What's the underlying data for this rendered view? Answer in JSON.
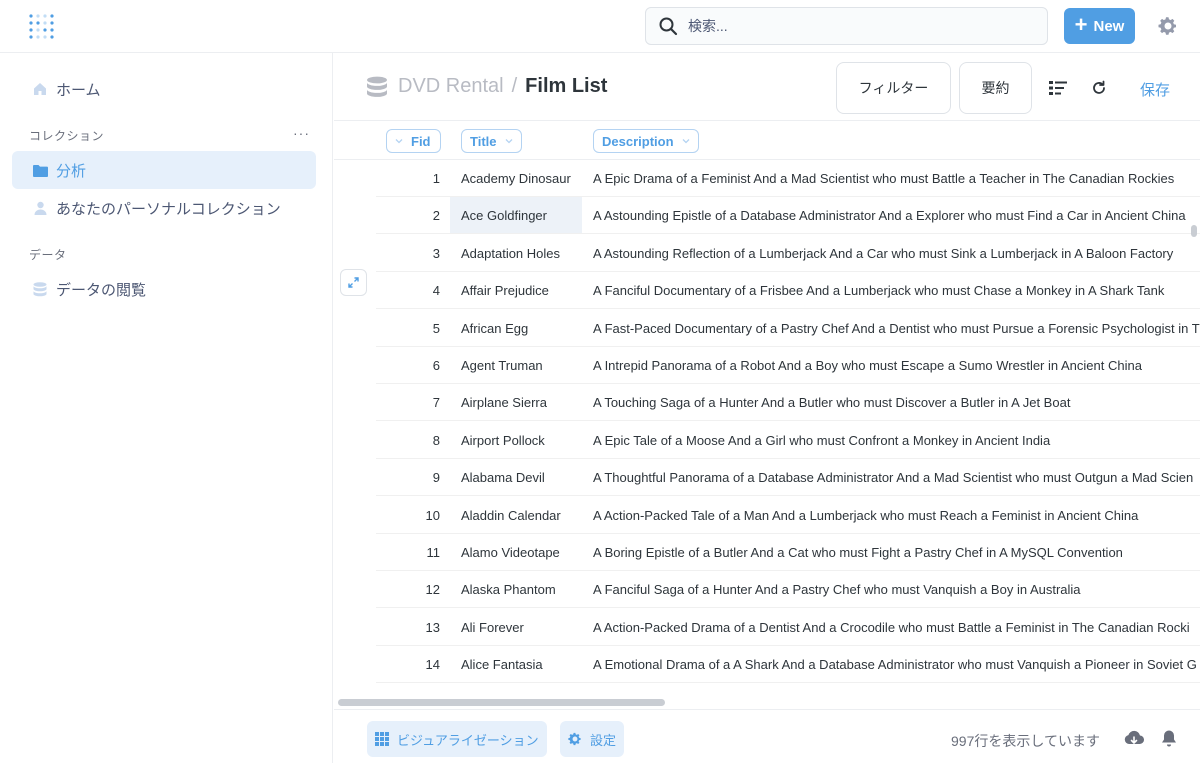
{
  "colors": {
    "brand": "#509ee3",
    "text": "#2e353b",
    "muted": "#696e7b"
  },
  "search": {
    "placeholder": "検索..."
  },
  "topbar": {
    "new_label": "New"
  },
  "sidebar": {
    "home_label": "ホーム",
    "collections_label": "コレクション",
    "more_label": "···",
    "items": [
      {
        "label": "分析",
        "icon": "folder-icon",
        "active": true
      },
      {
        "label": "あなたのパーソナルコレクション",
        "icon": "person-icon",
        "active": false
      }
    ],
    "data_label": "データ",
    "browse_label": "データの閲覧"
  },
  "header": {
    "database": "DVD Rental",
    "separator": "/",
    "title": "Film List",
    "filter_label": "フィルター",
    "summarize_label": "要約",
    "save_label": "保存"
  },
  "table": {
    "columns": [
      "Fid",
      "Title",
      "Description"
    ],
    "rows": [
      {
        "fid": "1",
        "title": "Academy Dinosaur",
        "description": "A Epic Drama of a Feminist And a Mad Scientist who must Battle a Teacher in The Canadian Rockies"
      },
      {
        "fid": "2",
        "title": "Ace Goldfinger",
        "description": "A Astounding Epistle of a Database Administrator And a Explorer who must Find a Car in Ancient China"
      },
      {
        "fid": "3",
        "title": "Adaptation Holes",
        "description": "A Astounding Reflection of a Lumberjack And a Car who must Sink a Lumberjack in A Baloon Factory"
      },
      {
        "fid": "4",
        "title": "Affair Prejudice",
        "description": "A Fanciful Documentary of a Frisbee And a Lumberjack who must Chase a Monkey in A Shark Tank"
      },
      {
        "fid": "5",
        "title": "African Egg",
        "description": "A Fast-Paced Documentary of a Pastry Chef And a Dentist who must Pursue a Forensic Psychologist in T"
      },
      {
        "fid": "6",
        "title": "Agent Truman",
        "description": "A Intrepid Panorama of a Robot And a Boy who must Escape a Sumo Wrestler in Ancient China"
      },
      {
        "fid": "7",
        "title": "Airplane Sierra",
        "description": "A Touching Saga of a Hunter And a Butler who must Discover a Butler in A Jet Boat"
      },
      {
        "fid": "8",
        "title": "Airport Pollock",
        "description": "A Epic Tale of a Moose And a Girl who must Confront a Monkey in Ancient India"
      },
      {
        "fid": "9",
        "title": "Alabama Devil",
        "description": "A Thoughtful Panorama of a Database Administrator And a Mad Scientist who must Outgun a Mad Scien"
      },
      {
        "fid": "10",
        "title": "Aladdin Calendar",
        "description": "A Action-Packed Tale of a Man And a Lumberjack who must Reach a Feminist in Ancient China"
      },
      {
        "fid": "11",
        "title": "Alamo Videotape",
        "description": "A Boring Epistle of a Butler And a Cat who must Fight a Pastry Chef in A MySQL Convention"
      },
      {
        "fid": "12",
        "title": "Alaska Phantom",
        "description": "A Fanciful Saga of a Hunter And a Pastry Chef who must Vanquish a Boy in Australia"
      },
      {
        "fid": "13",
        "title": "Ali Forever",
        "description": "A Action-Packed Drama of a Dentist And a Crocodile who must Battle a Feminist in The Canadian Rocki"
      },
      {
        "fid": "14",
        "title": "Alice Fantasia",
        "description": "A Emotional Drama of a A Shark And a Database Administrator who must Vanquish a Pioneer in Soviet G"
      }
    ]
  },
  "footer": {
    "visualize_label": "ビジュアライゼーション",
    "settings_label": "設定",
    "row_count": "997行を表示しています"
  }
}
